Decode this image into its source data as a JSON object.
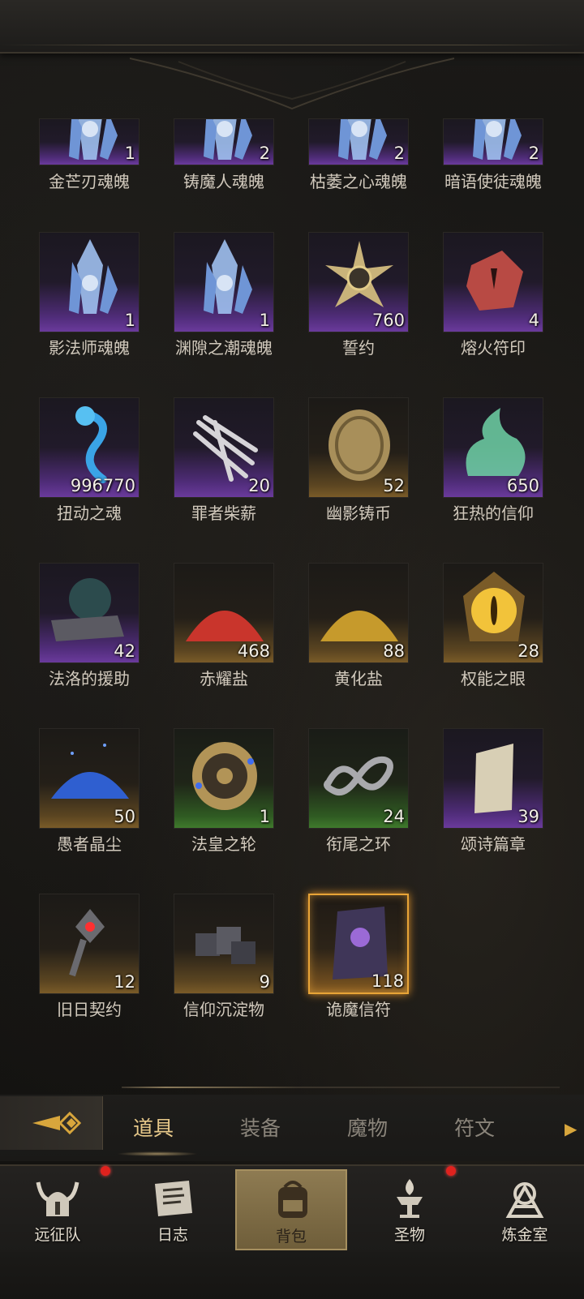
{
  "items": [
    {
      "name": "金芒刃魂魄",
      "count": "1",
      "rarity": "purple",
      "icon": "soul-crystal-icon",
      "partial": true
    },
    {
      "name": "铸魔人魂魄",
      "count": "2",
      "rarity": "purple",
      "icon": "soul-crystal-icon",
      "partial": true
    },
    {
      "name": "枯萎之心魂魄",
      "count": "2",
      "rarity": "purple",
      "icon": "soul-crystal-icon",
      "partial": true
    },
    {
      "name": "暗语使徒魂魄",
      "count": "2",
      "rarity": "purple",
      "icon": "soul-crystal-icon",
      "partial": true
    },
    {
      "name": "影法师魂魄",
      "count": "1",
      "rarity": "purple",
      "icon": "soul-crystal-icon"
    },
    {
      "name": "渊隙之潮魂魄",
      "count": "1",
      "rarity": "purple",
      "icon": "soul-crystal-icon"
    },
    {
      "name": "誓约",
      "count": "760",
      "rarity": "purple",
      "icon": "oath-star-icon"
    },
    {
      "name": "熔火符印",
      "count": "4",
      "rarity": "purple",
      "icon": "molten-rune-icon"
    },
    {
      "name": "扭动之魂",
      "count": "996770",
      "rarity": "purple",
      "icon": "twisted-soul-icon"
    },
    {
      "name": "罪者柴薪",
      "count": "20",
      "rarity": "purple",
      "icon": "sinner-firewood-icon"
    },
    {
      "name": "幽影铸币",
      "count": "52",
      "rarity": "gold",
      "icon": "shadow-coin-icon"
    },
    {
      "name": "狂热的信仰",
      "count": "650",
      "rarity": "purple",
      "icon": "zealous-faith-icon"
    },
    {
      "name": "法洛的援助",
      "count": "42",
      "rarity": "purple",
      "icon": "faro-aid-icon"
    },
    {
      "name": "赤耀盐",
      "count": "468",
      "rarity": "gold",
      "icon": "red-salt-icon"
    },
    {
      "name": "黄化盐",
      "count": "88",
      "rarity": "gold",
      "icon": "yellow-salt-icon"
    },
    {
      "name": "权能之眼",
      "count": "28",
      "rarity": "gold",
      "icon": "eye-of-power-icon"
    },
    {
      "name": "愚者晶尘",
      "count": "50",
      "rarity": "gold",
      "icon": "fool-crystal-dust-icon"
    },
    {
      "name": "法皇之轮",
      "count": "1",
      "rarity": "green",
      "icon": "pontiff-wheel-icon"
    },
    {
      "name": "衔尾之环",
      "count": "24",
      "rarity": "green",
      "icon": "ouroboros-ring-icon"
    },
    {
      "name": "颂诗篇章",
      "count": "39",
      "rarity": "purple",
      "icon": "hymn-page-icon"
    },
    {
      "name": "旧日契约",
      "count": "12",
      "rarity": "gold",
      "icon": "old-pact-icon"
    },
    {
      "name": "信仰沉淀物",
      "count": "9",
      "rarity": "gold",
      "icon": "faith-sediment-icon"
    },
    {
      "name": "诡魔信符",
      "count": "118",
      "rarity": "orange",
      "icon": "demon-talisman-icon"
    }
  ],
  "tabs": [
    {
      "label": "道具",
      "active": true
    },
    {
      "label": "装备",
      "active": false
    },
    {
      "label": "魔物",
      "active": false
    },
    {
      "label": "符文",
      "active": false
    }
  ],
  "nav": [
    {
      "label": "远征队",
      "icon": "horned-helmet-icon",
      "badge": true,
      "active": false
    },
    {
      "label": "日志",
      "icon": "scroll-icon",
      "badge": false,
      "active": false
    },
    {
      "label": "背包",
      "icon": "backpack-icon",
      "badge": false,
      "active": true
    },
    {
      "label": "圣物",
      "icon": "brazier-icon",
      "badge": true,
      "active": false
    },
    {
      "label": "炼金室",
      "icon": "alchemy-icon",
      "badge": false,
      "active": false
    }
  ],
  "colors": {
    "accent": "#e8c98a",
    "badge": "#e0221e",
    "purple": "#6a3a9c",
    "gold": "#7a5b28",
    "green": "#3f7a2c",
    "orange": "#e8a437"
  }
}
